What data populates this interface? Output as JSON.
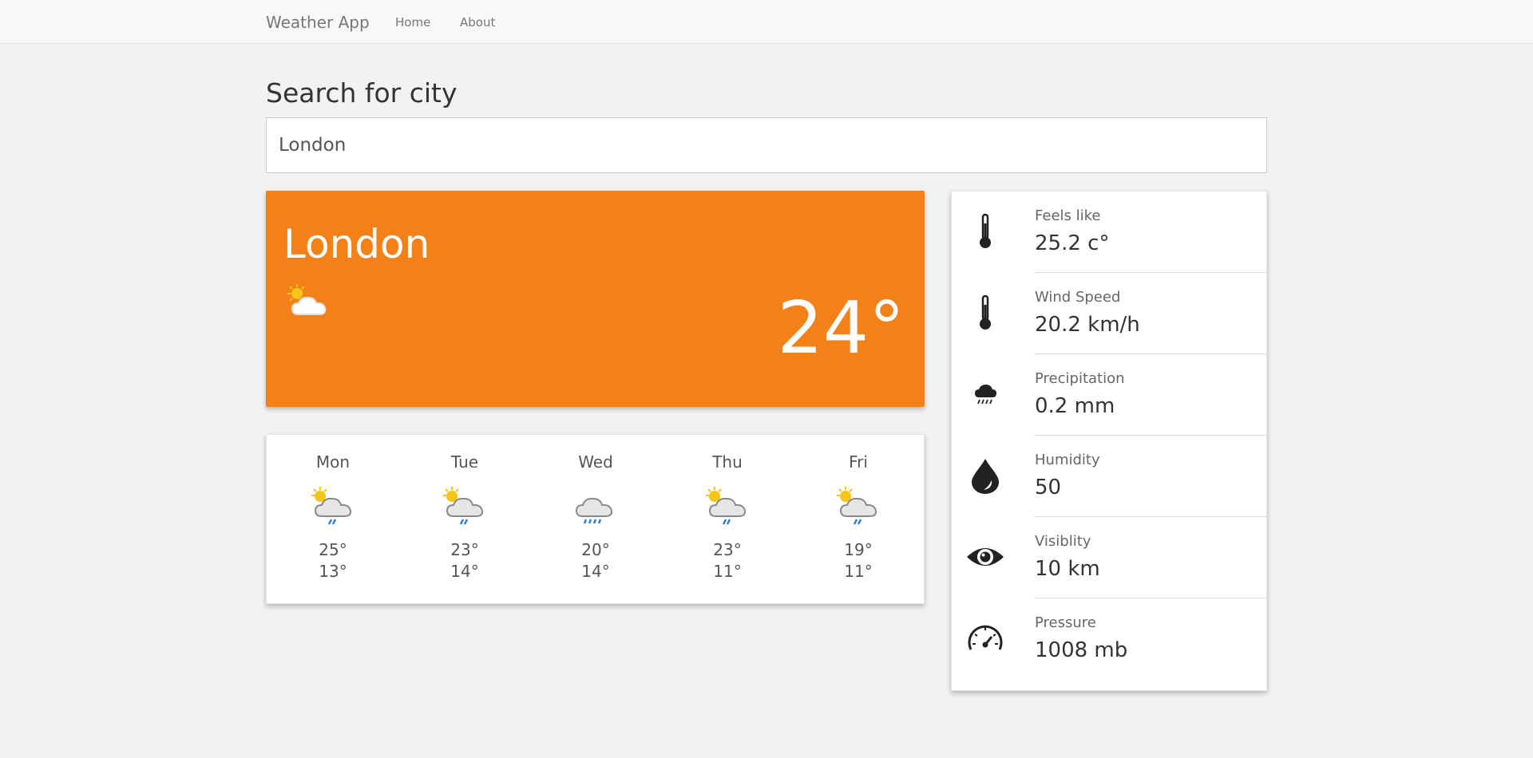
{
  "nav": {
    "brand": "Weather App",
    "links": [
      "Home",
      "About"
    ]
  },
  "search": {
    "title": "Search for city",
    "value": "London"
  },
  "current": {
    "city": "London",
    "temperature": "24°",
    "condition_icon": "partly-sunny-icon"
  },
  "forecast": [
    {
      "day": "Mon",
      "high": "25°",
      "low": "13°",
      "icon": "sun-cloud-rain-icon"
    },
    {
      "day": "Tue",
      "high": "23°",
      "low": "14°",
      "icon": "sun-cloud-rain-icon"
    },
    {
      "day": "Wed",
      "high": "20°",
      "low": "14°",
      "icon": "cloud-rain-icon"
    },
    {
      "day": "Thu",
      "high": "23°",
      "low": "11°",
      "icon": "sun-cloud-rain-icon"
    },
    {
      "day": "Fri",
      "high": "19°",
      "low": "11°",
      "icon": "sun-cloud-rain-icon"
    }
  ],
  "details": [
    {
      "label": "Feels like",
      "value": "25.2 c°",
      "icon": "thermometer-icon"
    },
    {
      "label": "Wind Speed",
      "value": "20.2 km/h",
      "icon": "thermometer-icon"
    },
    {
      "label": "Precipitation",
      "value": "0.2 mm",
      "icon": "rain-cloud-icon"
    },
    {
      "label": "Humidity",
      "value": "50",
      "icon": "water-drop-icon"
    },
    {
      "label": "Visiblity",
      "value": "10 km",
      "icon": "eye-icon"
    },
    {
      "label": "Pressure",
      "value": "1008 mb",
      "icon": "speedometer-icon"
    }
  ],
  "colors": {
    "accent": "#f48117",
    "background": "#f2f2f2"
  }
}
